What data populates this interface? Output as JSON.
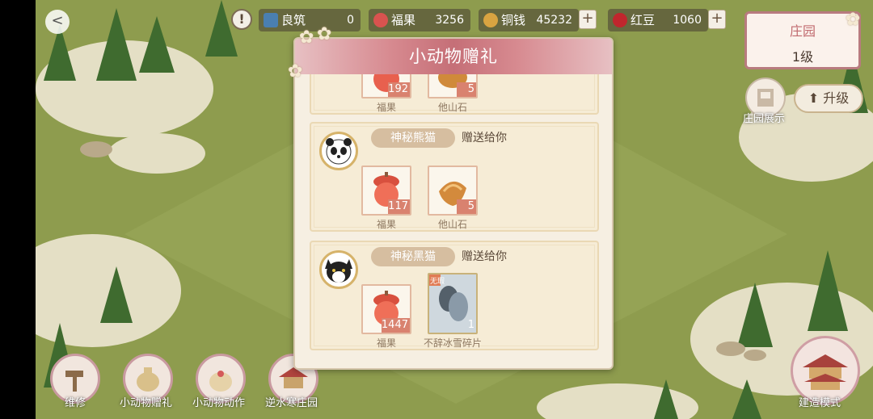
{
  "top_bar": {
    "back": "<",
    "warning": "!",
    "resources": [
      {
        "label": "良筑",
        "value": "0",
        "color": "#4a7fb0"
      },
      {
        "label": "福果",
        "value": "3256",
        "color": "#d9534f"
      },
      {
        "label": "铜钱",
        "value": "45232",
        "color": "#d9a441",
        "plus": "+"
      },
      {
        "label": "红豆",
        "value": "1060",
        "color": "#c0262d",
        "plus": "+"
      }
    ]
  },
  "estate": {
    "title": "庄园",
    "level": "1级"
  },
  "side": {
    "display_label": "庄园展示",
    "upgrade_label": "升级"
  },
  "bottom": {
    "buttons": [
      "维修",
      "小动物赠礼",
      "小动物动作",
      "逆水寒庄园"
    ],
    "build_label": "建造模式"
  },
  "dialog": {
    "title": "小动物赠礼",
    "partial_card": {
      "items": [
        {
          "name": "福果",
          "count": "192"
        },
        {
          "name": "他山石",
          "count": "5"
        }
      ]
    },
    "cards": [
      {
        "animal": "神秘熊猫",
        "send_text": "赠送给你",
        "items": [
          {
            "name": "福果",
            "count": "117"
          },
          {
            "name": "他山石",
            "count": "5"
          }
        ]
      },
      {
        "animal": "神秘黑猫",
        "send_text": "赠送给你",
        "items": [
          {
            "name": "福果",
            "count": "1447"
          },
          {
            "name": "不辞冰雪碎片",
            "count": "1",
            "tag": "无瑕"
          }
        ]
      }
    ]
  },
  "colors": {
    "accent": "#c56f77",
    "panel": "#f6efe2",
    "grass": "#8a9a4b"
  }
}
